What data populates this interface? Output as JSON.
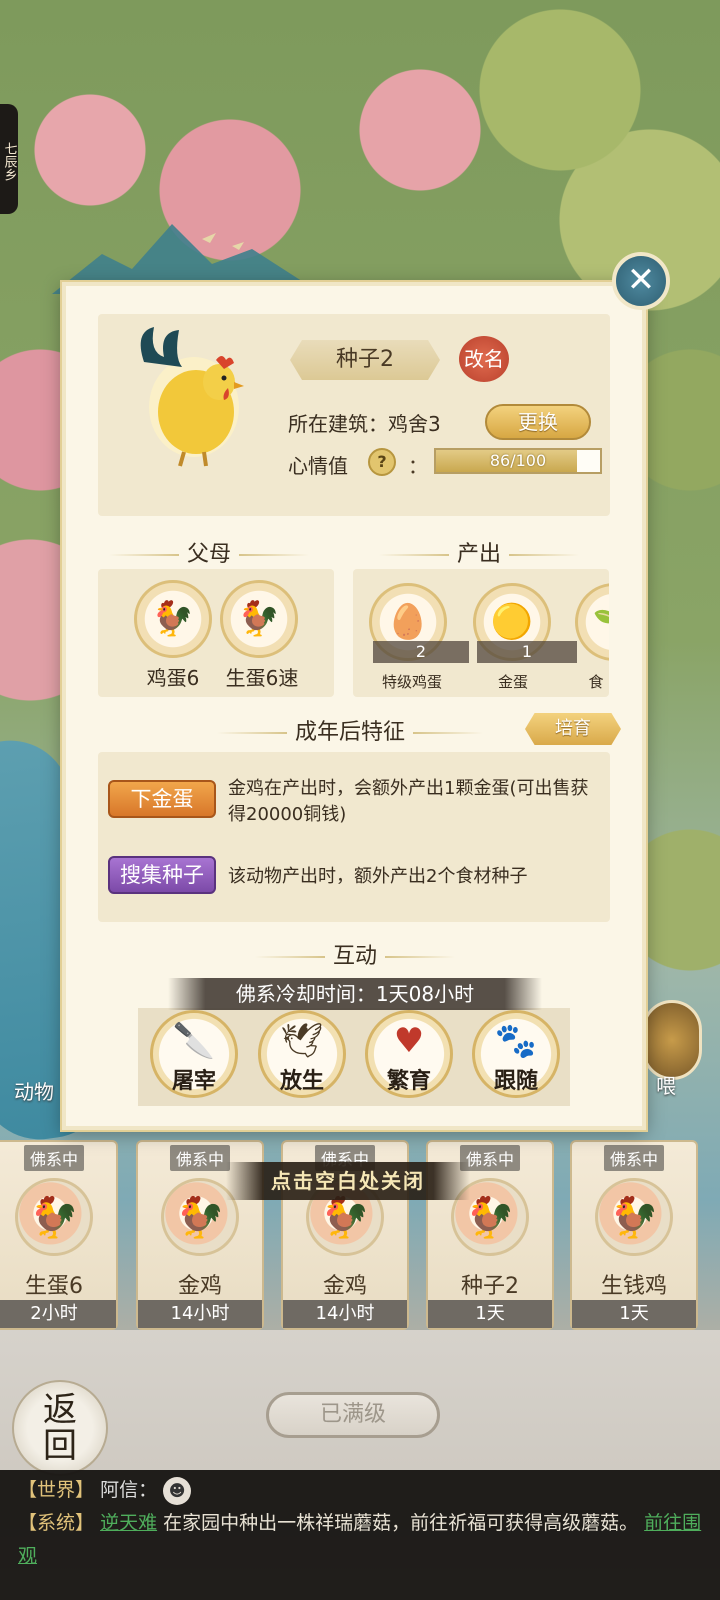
{
  "location": {
    "sign_text": "七辰乡"
  },
  "modal": {
    "close_icon": "close-x",
    "animal_name": "种子2",
    "rename_label": "改名",
    "building_label": "所在建筑：鸡舍3",
    "change_label": "更换",
    "mood_label": "心情值",
    "mood_help": "?",
    "mood_colon": "：",
    "mood_text": "86/100",
    "mood_fraction": 0.86,
    "sections": {
      "parents": "父母",
      "output": "产出",
      "traits": "成年后特征",
      "interact": "互动"
    },
    "parents": [
      {
        "name": "鸡蛋6"
      },
      {
        "name": "生蛋6速"
      }
    ],
    "outputs": [
      {
        "name": "特级鸡蛋",
        "count": "2",
        "icon": "egg-plate-icon"
      },
      {
        "name": "金蛋",
        "count": "1",
        "icon": "golden-egg-icon"
      },
      {
        "name": "食",
        "count": "",
        "icon": "food-seed-icon"
      }
    ],
    "cultivate_label": "培育",
    "traits": [
      {
        "tag": "下金蛋",
        "color": "gold",
        "desc": "金鸡在产出时，会额外产出1颗金蛋(可出售获得20000铜钱)"
      },
      {
        "tag": "搜集种子",
        "color": "purple",
        "desc": "该动物产出时，额外产出2个食材种子"
      }
    ],
    "cooldown": "佛系冷却时间：1天08小时",
    "interactions": [
      {
        "label": "屠宰",
        "icon": "cleaver-icon"
      },
      {
        "label": "放生",
        "icon": "bird-icon"
      },
      {
        "label": "繁育",
        "icon": "hearts-icon"
      },
      {
        "label": "跟随",
        "icon": "paw-icon"
      }
    ]
  },
  "close_hint": "点击空白处关闭",
  "side_labels": {
    "left": "动物",
    "right": "喂"
  },
  "animal_cards": [
    {
      "status": "佛系中",
      "name": "生蛋6",
      "time": "2小时"
    },
    {
      "status": "佛系中",
      "name": "金鸡",
      "time": "14小时"
    },
    {
      "status": "佛系中",
      "name": "金鸡",
      "time": "14小时"
    },
    {
      "status": "佛系中",
      "name": "种子2",
      "time": "1天"
    },
    {
      "status": "佛系中",
      "name": "生钱鸡",
      "time": "1天"
    }
  ],
  "maxed_label": "已满级",
  "back_label_top": "返",
  "back_label_bottom": "回",
  "chat": {
    "world_tag": "【世界】",
    "world_user": "阿信：",
    "system_tag": "【系统】",
    "system_user": "逆天难",
    "system_msg": " 在家园中种出一株祥瑞蘑菇，前往祈福可获得高级蘑菇。",
    "system_link": "前往围观"
  },
  "colors": {
    "modal_bg": "#fbf6e7",
    "panel_bg": "#f1e8cf",
    "gold_button": "#d7a743",
    "trait_gold": "#d8772a",
    "trait_purple": "#7c4aa8",
    "close_button": "#2f5f72"
  }
}
